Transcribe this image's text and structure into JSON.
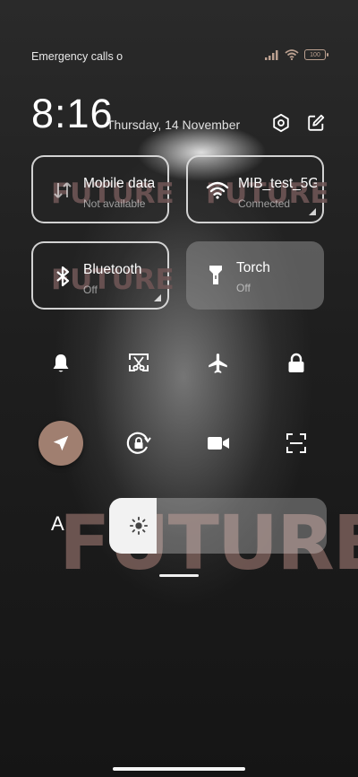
{
  "status_bar": {
    "carrier_text": "Emergency calls o",
    "battery_level": "100"
  },
  "header": {
    "time": "8:16",
    "date": "Thursday, 14 November"
  },
  "tiles": [
    {
      "title": "Mobile data",
      "subtitle": "Not available",
      "icon": "mobile-data-icon",
      "state": "active",
      "overlay": "FUTURE"
    },
    {
      "title": "MIB_test_5G",
      "subtitle": "Connected",
      "icon": "wifi-icon",
      "state": "active",
      "overlay": "FUTURE"
    },
    {
      "title": "Bluetooth",
      "subtitle": "Off",
      "icon": "bluetooth-icon",
      "state": "active",
      "overlay": "FUTURE"
    },
    {
      "title": "Torch",
      "subtitle": "Off",
      "icon": "torch-icon",
      "state": "inactive"
    }
  ],
  "toggles": [
    {
      "icon": "bell-icon",
      "state": "off"
    },
    {
      "icon": "screenshot-icon",
      "state": "off"
    },
    {
      "icon": "airplane-icon",
      "state": "off"
    },
    {
      "icon": "lock-icon",
      "state": "off"
    },
    {
      "icon": "location-icon",
      "state": "on"
    },
    {
      "icon": "rotation-lock-icon",
      "state": "off"
    },
    {
      "icon": "video-camera-icon",
      "state": "off"
    },
    {
      "icon": "scan-icon",
      "state": "off"
    }
  ],
  "brightness": {
    "auto_label": "A",
    "level": 0.22,
    "icon": "sun-icon"
  },
  "wallpaper_text": "FUTURE",
  "colors": {
    "accent_toggle": "#a07f70",
    "panel_bg": "#1f1f1f"
  }
}
